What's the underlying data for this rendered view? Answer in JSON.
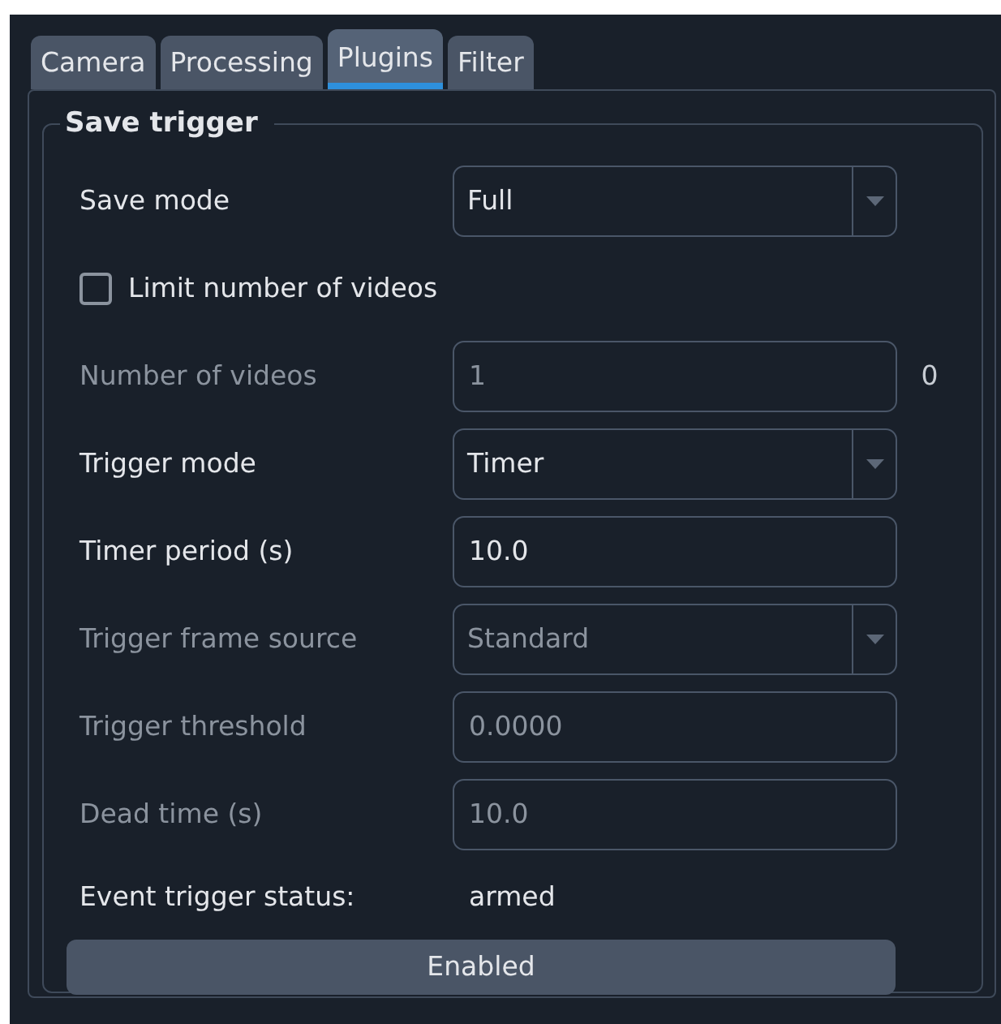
{
  "tabs": [
    {
      "label": "Camera",
      "selected": false
    },
    {
      "label": "Processing",
      "selected": false
    },
    {
      "label": "Plugins",
      "selected": true
    },
    {
      "label": "Filter",
      "selected": false
    }
  ],
  "group": {
    "title": "Save trigger",
    "rows": [
      {
        "kind": "combo",
        "label": "Save mode",
        "value": "Full",
        "disabled": false
      },
      {
        "kind": "checkbox",
        "label": "Limit number of videos",
        "checked": false
      },
      {
        "kind": "field",
        "label": "Number of videos",
        "value": "1",
        "suffix": "0",
        "disabled": true
      },
      {
        "kind": "combo",
        "label": "Trigger mode",
        "value": "Timer",
        "disabled": false
      },
      {
        "kind": "field",
        "label": "Timer period (s)",
        "value": "10.0",
        "disabled": false
      },
      {
        "kind": "combo",
        "label": "Trigger frame source",
        "value": "Standard",
        "disabled": true
      },
      {
        "kind": "field",
        "label": "Trigger threshold",
        "value": "0.0000",
        "disabled": true
      },
      {
        "kind": "field",
        "label": "Dead time (s)",
        "value": "10.0",
        "disabled": true
      },
      {
        "kind": "status",
        "label": "Event trigger status:",
        "value": "armed"
      }
    ],
    "button": "Enabled"
  }
}
